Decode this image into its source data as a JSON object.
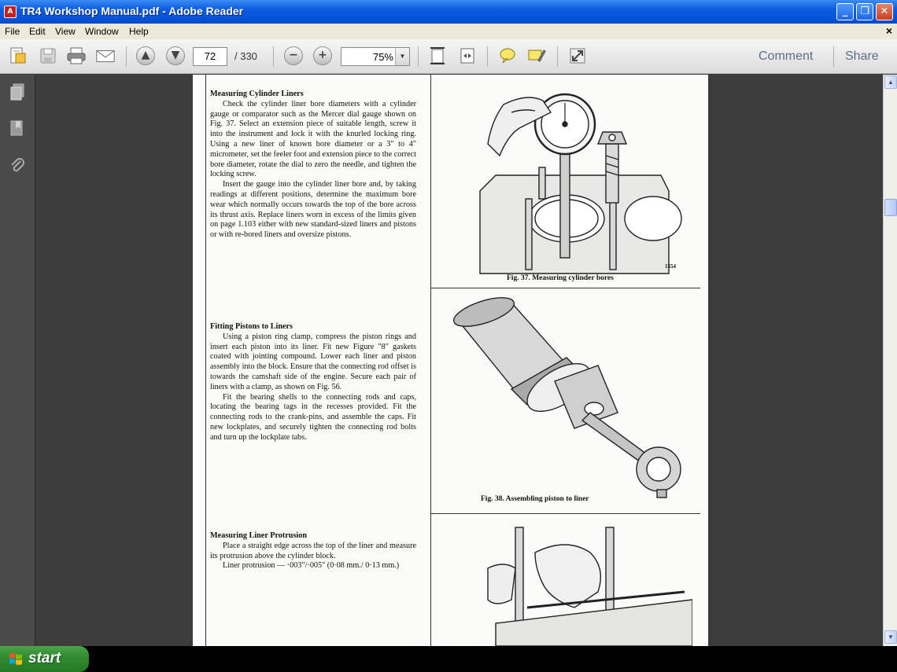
{
  "window": {
    "title": "TR4  Workshop Manual.pdf - Adobe Reader",
    "min_glyph": "_",
    "max_glyph": "❐",
    "close_glyph": "✕"
  },
  "menu": {
    "items": [
      "File",
      "Edit",
      "View",
      "Window",
      "Help"
    ],
    "doc_close": "×"
  },
  "toolbar": {
    "page_current": "72",
    "page_total": "/ 330",
    "zoom_value": "75%",
    "zoom_minus": "−",
    "zoom_plus": "+",
    "comment_label": "Comment",
    "share_label": "Share"
  },
  "document": {
    "sections": [
      {
        "heading": "Measuring Cylinder Liners",
        "paragraphs": [
          "Check the cylinder liner bore diameters with a cylinder gauge or comparator such as the Mercer dial gauge shown on Fig. 37. Select an extension piece of suitable length, screw it into the instrument and lock it with the knurled locking ring. Using a new liner of known bore diameter or a 3\" to 4\" micrometer, set the feeler foot and extension piece to the correct bore diameter, rotate the dial to zero the needle, and tighten the locking screw.",
          "Insert the gauge into the cylinder liner bore and, by taking readings at different positions, determine the maximum bore wear which normally occurs towards the top of the bore across its thrust axis. Replace liners worn in excess of the limits given on page 1.103 either with new standard-sized liners and pistons or with re-bored liners and oversize pistons."
        ]
      },
      {
        "heading": "Fitting Pistons to Liners",
        "paragraphs": [
          "Using a piston ring clamp, compress the piston rings and insert each piston into its liner. Fit new Figure \"8\" gaskets coated with jointing compound. Lower each liner and piston assembly into the block. Ensure that the connecting rod offset is towards the camshaft side of the engine. Secure each pair of liners with a clamp, as shown on Fig. 56.",
          "Fit the bearing shells to the connecting rods and caps, locating the bearing tags in the recesses provided. Fit the connecting rods to the crank-pins, and assemble the caps. Fit new lockplates, and securely tighten the connecting rod bolts and turn up the lockplate tabs."
        ]
      },
      {
        "heading": "Measuring Liner Protrusion",
        "paragraphs": [
          "Place a straight edge across the top of the liner and measure its protrusion above the cylinder block.",
          "Liner protrusion — ·003\"/·005\" (0·08 mm./ 0·13 mm.)"
        ]
      }
    ],
    "figures": [
      {
        "caption": "Fig. 37.   Measuring cylinder bores",
        "tag": "1554"
      },
      {
        "caption": "Fig. 38.   Assembling piston to liner"
      },
      {
        "caption": ""
      }
    ]
  },
  "taskbar": {
    "start_label": "start"
  },
  "colors": {
    "titlebar": "#0450d6",
    "start_green": "#2f8a2f",
    "page_bg": "#fbfbf9",
    "doc_bg": "#3c3c3c"
  },
  "icons": [
    "pdf-app-icon",
    "create-pdf-icon",
    "save-icon",
    "print-icon",
    "email-icon",
    "previous-page-icon",
    "next-page-icon",
    "zoom-out-icon",
    "zoom-in-icon",
    "fit-page-icon",
    "fit-width-icon",
    "sticky-note-icon",
    "highlight-icon",
    "full-screen-icon",
    "pages-panel-icon",
    "bookmarks-icon",
    "attachments-icon",
    "windows-flag-icon"
  ]
}
